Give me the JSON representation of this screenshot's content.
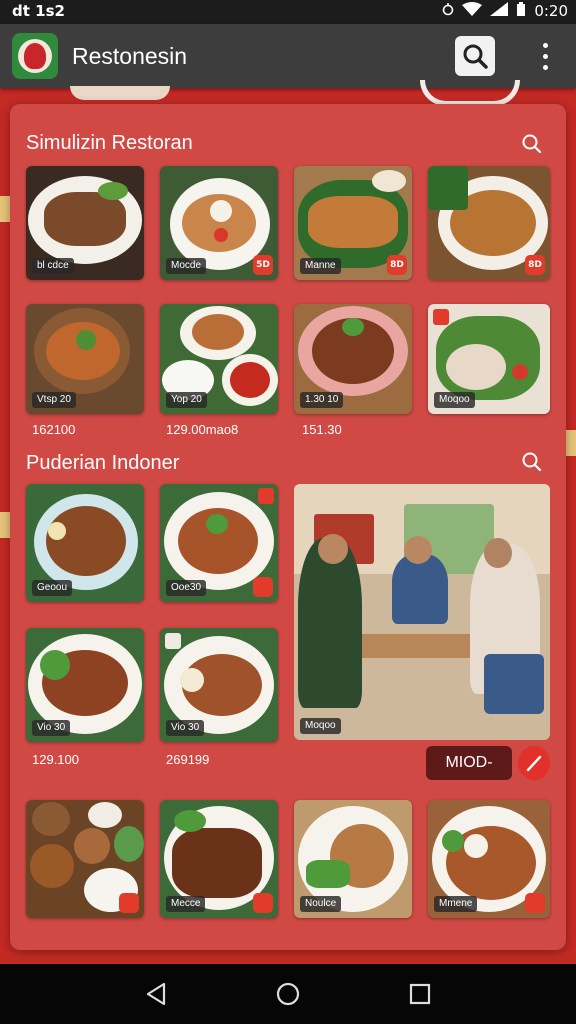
{
  "status_bar": {
    "left": "dt  1s2",
    "time": "0:20"
  },
  "app_bar": {
    "title": "Restonesin"
  },
  "section1": {
    "title": "Simulizin Restoran",
    "items": [
      {
        "tag": "bl cdce",
        "badge": "",
        "price": ""
      },
      {
        "tag": "Mocde",
        "badge": "5D",
        "price": ""
      },
      {
        "tag": "Manne",
        "badge": "8D",
        "price": ""
      },
      {
        "tag": "",
        "badge": "8D",
        "price": ""
      },
      {
        "tag": "Vtsp 20",
        "badge": "",
        "price": "162100"
      },
      {
        "tag": "Yop 20",
        "badge": "",
        "price": "129.00mao8"
      },
      {
        "tag": "1.30 10",
        "badge": "",
        "price": "151.30"
      },
      {
        "tag": "Moqoo",
        "badge": "",
        "price": ""
      }
    ]
  },
  "section2": {
    "title": "Puderian Indoner",
    "items": [
      {
        "tag": "Geoou",
        "badge": "",
        "price": ""
      },
      {
        "tag": "Ooe30",
        "badge": "",
        "price": ""
      },
      {
        "tag": "Vio 30",
        "badge": "",
        "price": "129.100"
      },
      {
        "tag": "Vio 30",
        "badge": "",
        "price": "269199"
      }
    ],
    "photo_tag": "Moqoo",
    "action_label": "MIOD-"
  },
  "section3": {
    "items": [
      {
        "tag": ""
      },
      {
        "tag": "Mecce"
      },
      {
        "tag": "Noulce"
      },
      {
        "tag": "Mmene"
      }
    ]
  },
  "icons": {
    "logo": "restaurant-logo-icon",
    "search": "search-icon",
    "menu": "overflow-menu-icon",
    "back": "nav-back-icon",
    "home": "nav-home-icon",
    "recents": "nav-recents-icon",
    "edit": "edit-icon"
  },
  "colors": {
    "background": "#c42a24",
    "panel": "#d04945",
    "app_bar": "#3d3d3d",
    "accent": "#e2302a"
  }
}
